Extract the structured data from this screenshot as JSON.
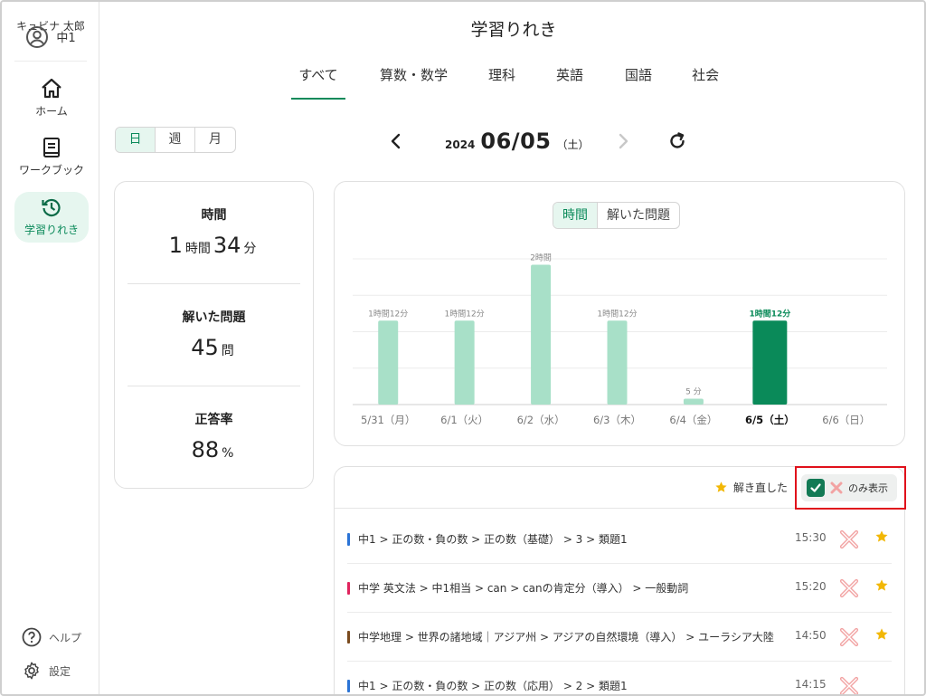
{
  "sidebar": {
    "grade": "中1",
    "user_name": "キュビナ 太郎",
    "items": [
      {
        "label": "ホーム"
      },
      {
        "label": "ワークブック"
      },
      {
        "label": "学習りれき"
      }
    ],
    "help": "ヘルプ",
    "settings": "設定"
  },
  "header": {
    "title": "学習りれき"
  },
  "tabs": [
    {
      "label": "すべて",
      "active": true
    },
    {
      "label": "算数・数学"
    },
    {
      "label": "理科"
    },
    {
      "label": "英語"
    },
    {
      "label": "国語"
    },
    {
      "label": "社会"
    }
  ],
  "period": {
    "options": [
      "日",
      "週",
      "月"
    ],
    "selected": "日"
  },
  "date": {
    "year": "2024",
    "md": "06/05",
    "dow": "（土）"
  },
  "summary": {
    "time_label": "時間",
    "time_h": "1",
    "time_h_unit": "時間",
    "time_m": "34",
    "time_m_unit": "分",
    "solved_label": "解いた問題",
    "solved_value": "45",
    "solved_unit": "問",
    "accuracy_label": "正答率",
    "accuracy_value": "88",
    "accuracy_unit": "%"
  },
  "chart_toggle": {
    "options": [
      "時間",
      "解いた問題"
    ],
    "selected": "時間"
  },
  "chart_data": {
    "type": "bar",
    "categories": [
      "5/31（月）",
      "6/1（火）",
      "6/2（水）",
      "6/3（木）",
      "6/4（金）",
      "6/5（土）",
      "6/6（日）"
    ],
    "values": [
      72,
      72,
      120,
      72,
      5,
      72,
      0
    ],
    "data_labels": [
      "1時間12分",
      "1時間12分",
      "2時間",
      "1時間12分",
      "5 分",
      "1時間12分",
      ""
    ],
    "selected_index": 5,
    "ylim": [
      0,
      125
    ],
    "grid": true,
    "colors": {
      "bar": "#a8e0c8",
      "selected": "#0a8a59"
    }
  },
  "list": {
    "retried_label": "解き直した",
    "filter_label": "のみ表示",
    "filter_checked": true,
    "rows": [
      {
        "path": "中1 > 正の数・負の数 > 正の数（基礎） > 3 > 類題1",
        "time": "15:30",
        "color": "#2b74d6",
        "starred": true
      },
      {
        "path": "中学 英文法 > 中1相当 > can > canの肯定分（導入） > 一般動詞",
        "time": "15:20",
        "color": "#e0245e",
        "starred": true
      },
      {
        "path": "中学地理 > 世界の諸地域｜アジア州 > アジアの自然環境（導入） > ユーラシア大陸",
        "time": "14:50",
        "color": "#7a4a1e",
        "starred": true
      },
      {
        "path": "中1 > 正の数・負の数 > 正の数（応用） > 2 > 類題1",
        "time": "14:15",
        "color": "#2b74d6",
        "starred": false
      }
    ]
  }
}
